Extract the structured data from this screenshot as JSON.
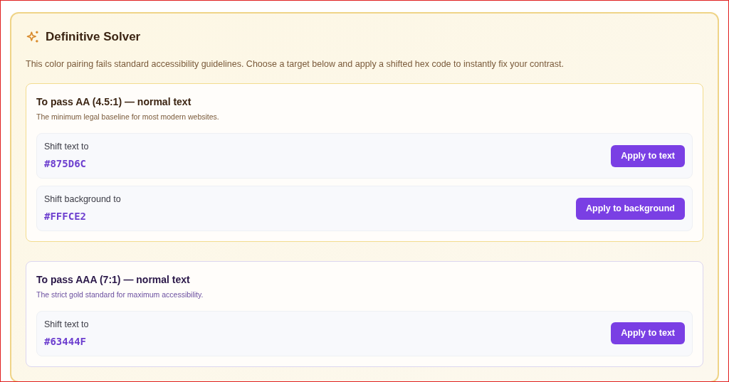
{
  "title": "Definitive Solver",
  "description": "This color pairing fails standard accessibility guidelines. Choose a target below and apply a shifted hex code to instantly fix your contrast.",
  "targets": [
    {
      "kind": "aa",
      "title": "To pass AA (4.5:1) — normal text",
      "subtitle": "The minimum legal baseline for most modern websites.",
      "options": [
        {
          "label": "Shift text to",
          "hex": "#875D6C",
          "button": "Apply to text"
        },
        {
          "label": "Shift background to",
          "hex": "#FFFCE2",
          "button": "Apply to background"
        }
      ]
    },
    {
      "kind": "aaa",
      "title": "To pass AAA (7:1) — normal text",
      "subtitle": "The strict gold standard for maximum accessibility.",
      "options": [
        {
          "label": "Shift text to",
          "hex": "#63444F",
          "button": "Apply to text"
        }
      ]
    }
  ]
}
